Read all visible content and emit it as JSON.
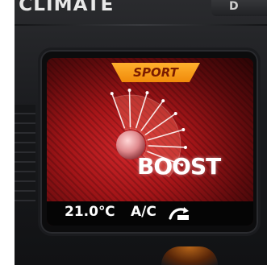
{
  "panel": {
    "climate_label": "CLIMATE",
    "top_right_key": "D"
  },
  "screen": {
    "mode_badge": "SPORT",
    "boost_label": "BOOST",
    "gauge": {
      "segments_total": 8,
      "segments_active": 8
    },
    "status": {
      "temperature": "21.0℃",
      "ac_label": "A/C",
      "recirculation_icon": "recirculation-icon"
    }
  },
  "colors": {
    "screen_red": "#c0181c",
    "badge_orange": "#f5a020",
    "text_white": "#ffffff"
  }
}
